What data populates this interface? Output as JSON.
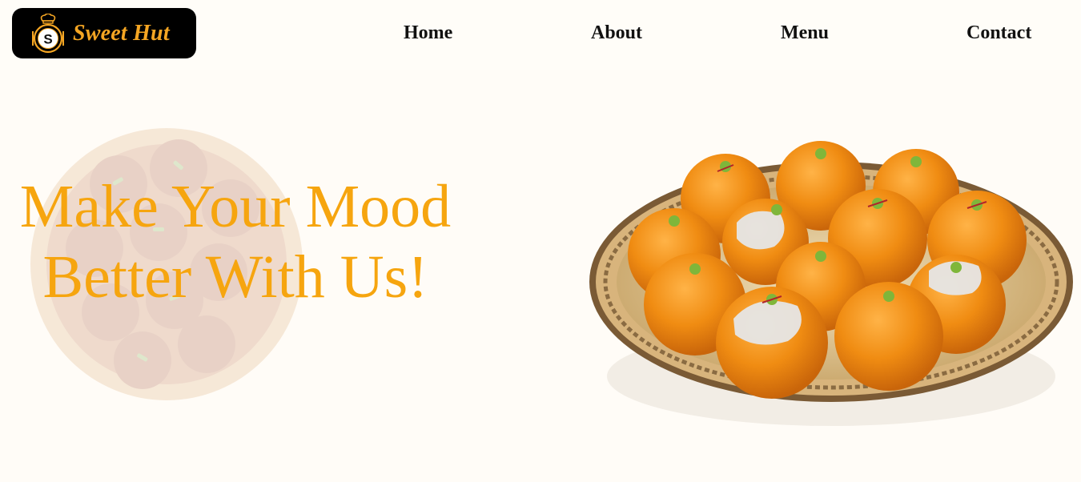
{
  "brand": {
    "name": "Sweet Hut",
    "icon": "chef-hat-s-badge-icon",
    "text_color": "#f5a623",
    "badge_color": "#000000"
  },
  "nav": {
    "items": [
      {
        "label": "Home"
      },
      {
        "label": "About"
      },
      {
        "label": "Menu"
      },
      {
        "label": "Contact"
      }
    ]
  },
  "hero": {
    "line1": "Make Your Mood",
    "line2": "Better With Us!",
    "accent_color": "#f6a50f",
    "image_left": "gulab-jamun-bowl",
    "image_right": "motichoor-laddoo-plate"
  }
}
